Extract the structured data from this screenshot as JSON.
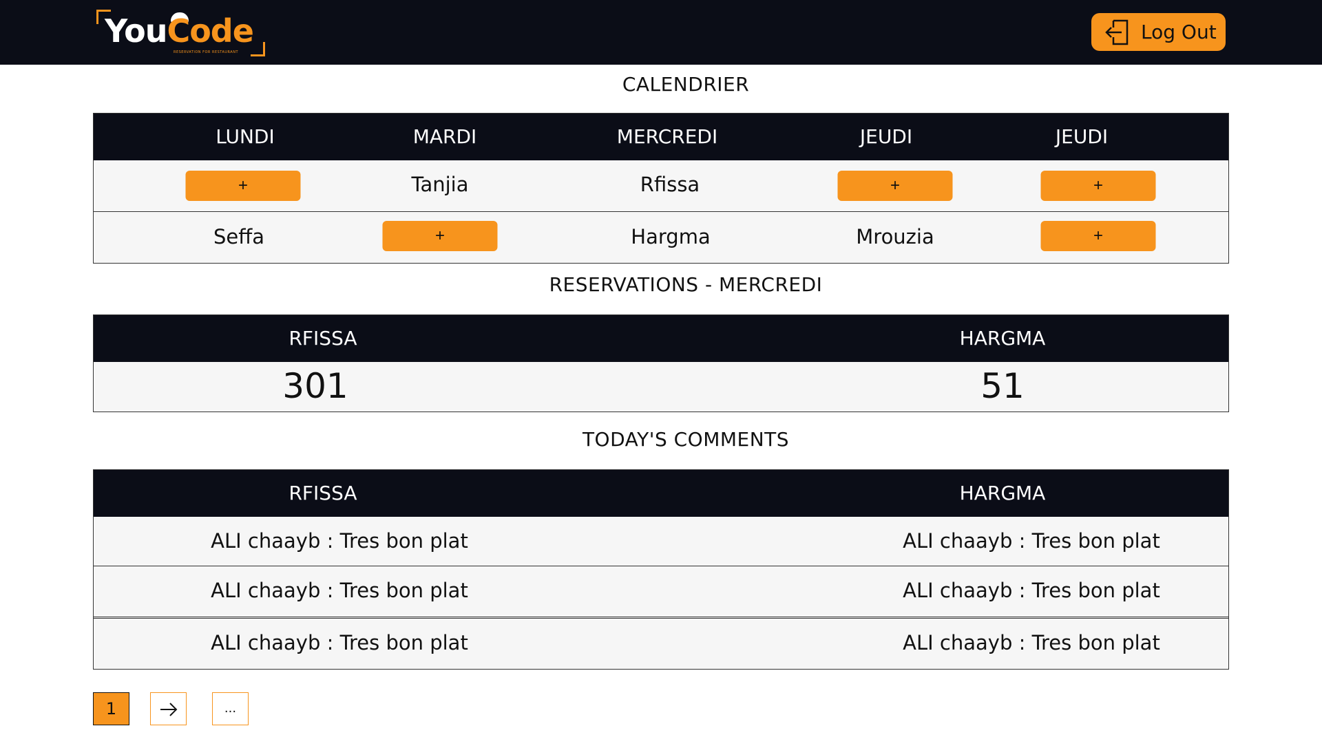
{
  "brand": {
    "logo_you": "You",
    "logo_code": "Code",
    "logo_tagline": "RESERVATION FOR RESTAURANT",
    "accent": "#f7941d",
    "dark": "#0b0d17"
  },
  "header": {
    "logout_label": "Log Out",
    "logout_icon": "logout-icon"
  },
  "calendar": {
    "title": "CALENDRIER",
    "days": [
      "LUNDI",
      "MARDI",
      "MERCREDI",
      "JEUDI",
      "JEUDI"
    ],
    "rows": [
      [
        "+",
        "Tanjia",
        "Rfissa",
        "+",
        "+"
      ],
      [
        "Seffa",
        "+",
        "Hargma",
        "Mrouzia",
        "+"
      ]
    ]
  },
  "reservations": {
    "title": "RESERVATIONS - MERCREDI",
    "columns": [
      "RFISSA",
      "HARGMA"
    ],
    "values": [
      "301",
      "51"
    ]
  },
  "comments": {
    "title": "TODAY'S COMMENTS",
    "columns": [
      "RFISSA",
      "HARGMA"
    ],
    "rows": [
      [
        "ALI chaayb : Tres bon plat",
        "ALI chaayb : Tres bon plat"
      ],
      [
        "ALI chaayb : Tres bon plat",
        "ALI chaayb : Tres bon plat"
      ],
      [
        "ALI chaayb : Tres bon plat",
        "ALI chaayb : Tres bon plat"
      ]
    ]
  },
  "pagination": {
    "current": "1",
    "next_icon": "arrow-right-icon",
    "more": "..."
  }
}
